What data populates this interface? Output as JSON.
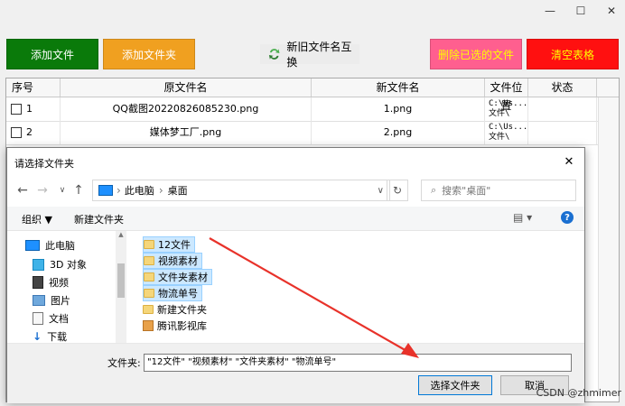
{
  "window": {
    "minimize": "—",
    "maximize": "☐",
    "close": "✕"
  },
  "toolbar": {
    "add_file": "添加文件",
    "add_folder": "添加文件夹",
    "swap": "新旧文件名互换",
    "delete_selected": "删除已选的文件",
    "clear_table": "清空表格"
  },
  "colors": {
    "green": "#0a7a0a",
    "orange": "#f0a020",
    "pink": "#ff5f8f",
    "red": "#ff1010"
  },
  "table": {
    "headers": [
      "序号",
      "原文件名",
      "新文件名",
      "文件位置",
      "状态"
    ],
    "rows": [
      {
        "index": "1",
        "original": "QQ截图20220826085230.png",
        "new": "1.png",
        "location": "C:\\Us...\n文件\\"
      },
      {
        "index": "2",
        "original": "媒体梦工厂.png",
        "new": "2.png",
        "location": "C:\\Us...\n文件\\"
      }
    ]
  },
  "dialog": {
    "title": "请选择文件夹",
    "close": "✕",
    "breadcrumb": [
      "此电脑",
      "桌面"
    ],
    "search_placeholder": "搜索\"桌面\"",
    "organize": "组织 ▼",
    "new_folder": "新建文件夹",
    "help": "?",
    "view": "▤ ▾",
    "tree": [
      "此电脑",
      "3D 对象",
      "视频",
      "图片",
      "文档",
      "下载"
    ],
    "files": [
      {
        "name": "12文件",
        "selected": true
      },
      {
        "name": "视频素材",
        "selected": true
      },
      {
        "name": "文件夹素材",
        "selected": true
      },
      {
        "name": "物流单号",
        "selected": true
      },
      {
        "name": "新建文件夹",
        "selected": false
      },
      {
        "name": "腾讯影视库",
        "selected": false
      }
    ],
    "folder_label": "文件夹:",
    "folder_value": "\"12文件\" \"视频素材\" \"文件夹素材\" \"物流单号\"",
    "select_button": "选择文件夹",
    "cancel_button": "取消"
  },
  "watermark": "CSDN @zhmimer"
}
